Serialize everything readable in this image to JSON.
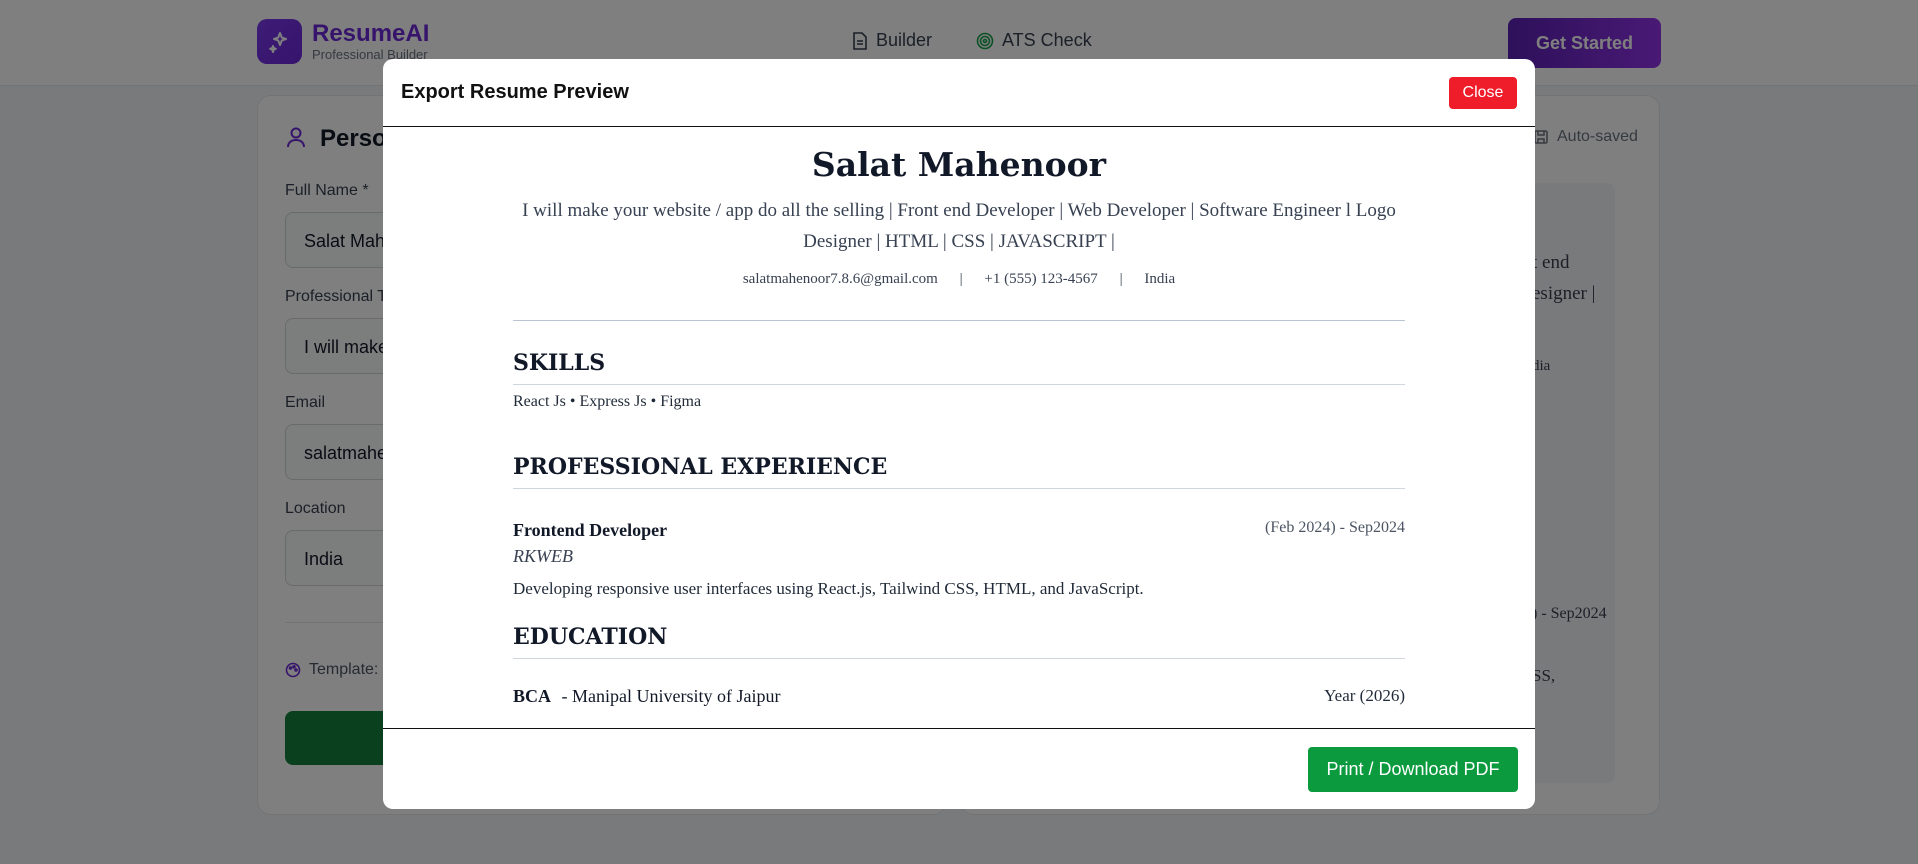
{
  "app": {
    "brand": "ResumeAI",
    "brand_sub": "Professional Builder",
    "nav": [
      {
        "label": "Builder",
        "icon": "document-icon"
      },
      {
        "label": "ATS Check",
        "icon": "target-icon"
      }
    ],
    "cta_label": "Get Started"
  },
  "background": {
    "section_title": "Perso",
    "auto_saved": "Auto-saved",
    "fields": [
      {
        "label": "Full Name *",
        "value": "Salat Mah"
      },
      {
        "label": "Professional T",
        "value": "I will make"
      },
      {
        "label": "Email",
        "value": "salatmahe"
      },
      {
        "label": "Location",
        "value": "India"
      }
    ],
    "template_label": "Template:",
    "preview_fragments": {
      "line1": "t end",
      "line2": "esigner |",
      "line3": "dia",
      "date": ") - Sep2024",
      "ss": "SS,"
    }
  },
  "modal": {
    "title": "Export Resume Preview",
    "close_label": "Close",
    "print_label": "Print / Download PDF"
  },
  "resume": {
    "name": "Salat Mahenoor",
    "headline": "I will make your website / app do all the selling | Front end Developer | Web Developer | Software Engineer l Logo Designer | HTML | CSS | JAVASCRIPT |",
    "contact": {
      "email": "salatmahenoor7.8.6@gmail.com",
      "phone": "+1 (555) 123-4567",
      "location": "India",
      "separator": "|"
    },
    "skills_heading": "SKILLS",
    "skills": "React Js • Express Js • Figma",
    "experience_heading": "PROFESSIONAL EXPERIENCE",
    "experience": {
      "title": "Frontend Developer",
      "date": "(Feb 2024) - Sep2024",
      "company": "RKWEB",
      "description": "Developing responsive user interfaces using React.js, Tailwind CSS, HTML, and JavaScript."
    },
    "education_heading": "EDUCATION",
    "education": {
      "degree": "BCA",
      "school": "- Manipal University of Jaipur",
      "year": "Year (2026)"
    }
  },
  "colors": {
    "brand": "#6d28d9",
    "close": "#ef1c2a",
    "print": "#0b9a3d",
    "export_bg": "#15803d"
  }
}
